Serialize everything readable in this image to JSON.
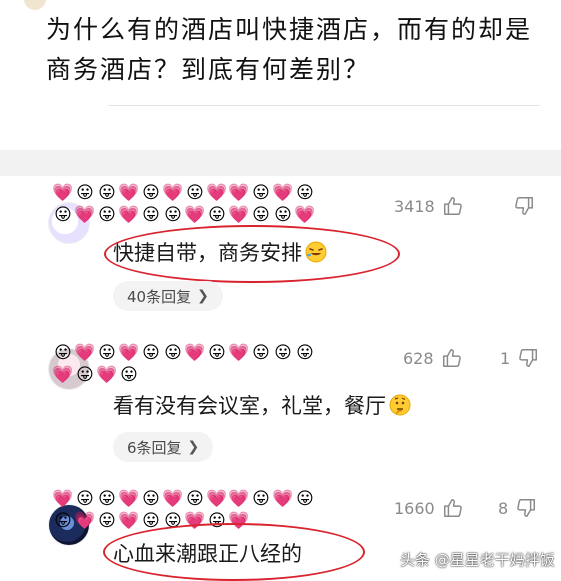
{
  "article": {
    "title_line1": "为什么有的酒店叫快捷酒店，而有的却是",
    "title_line2": "商务酒店？到底有何差别？"
  },
  "icons": {
    "like": "thumbs-up-icon",
    "dislike": "thumbs-down-icon",
    "reply_arrow": "chevron-right-icon",
    "username_emoji_a": "😛",
    "username_emoji_b": "💗"
  },
  "colors": {
    "annotation_circle": "#d9242f",
    "reply_pill_bg": "#f3f3f3",
    "meta_text": "#8a8a8a"
  },
  "comments": [
    {
      "likes": "3418",
      "dislikes": "",
      "text": "快捷自带，商务安排",
      "emoji": "rolling-on-floor-laughing-icon",
      "replies": "40条回复"
    },
    {
      "likes": "628",
      "dislikes": "1",
      "text": "看有没有会议室，礼堂，餐厅",
      "emoji": "thinking-face-icon",
      "replies": "6条回复"
    },
    {
      "likes": "1660",
      "dislikes": "8",
      "text": "心血来潮跟正八经的",
      "emoji": "",
      "replies": ""
    }
  ],
  "watermark": "头条 @星星老干妈拌饭"
}
